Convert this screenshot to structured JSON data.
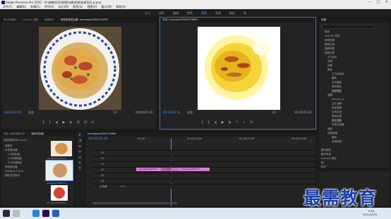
{
  "window": {
    "title": "Adobe Premiere Pro 2020 - D:\\做教程\\SO视频\\电影视频\\新建项目.prproj",
    "minimize": "—",
    "maximize": "□",
    "close": "✕"
  },
  "menu": [
    "文件(F)",
    "编辑(E)",
    "剪辑(C)",
    "序列(S)",
    "标记(M)",
    "图形(G)",
    "视图(V)",
    "窗口(W)",
    "帮助(H)"
  ],
  "workspaces": [
    "学习",
    "组件",
    "编辑",
    "颜色",
    "效果",
    "音频",
    "图形",
    "库"
  ],
  "active_workspace": "效果",
  "source_monitor": {
    "tabs": [
      "源:(无剪辑)",
      "Lumetri 范围",
      "效果控件",
      "音频剪辑混合器: mmexport1635174659"
    ],
    "timecode": "00;00;00;00",
    "fit": "适合",
    "ratio": "1/2",
    "end": "00;00;05;00"
  },
  "program_monitor": {
    "tabs": [
      "节目: mmexport1635174669"
    ],
    "timecode": "00;00;02;16",
    "fit": "适合",
    "ratio": "1/2",
    "end": "00;00;05;18"
  },
  "project": {
    "tabs": [
      "项目: 电影视频文件",
      "媒体浏览器",
      "库",
      "信息",
      "效果"
    ],
    "path": "电影视频文件.prproj",
    "items": [
      "mmexport163517...",
      "mmexport163517...",
      "mmexport163517..."
    ],
    "folder_items": [
      "收藏夹",
      "本地驱动器",
      "C:(系统/盘)",
      "D:(本地磁盘)",
      "E:(本地磁盘)",
      "网络驱动器",
      "Creative Cloud",
      "团队项目版本"
    ]
  },
  "timeline": {
    "tab": "mmexport1635174669",
    "timecode": "00;00;02;16",
    "ruler": [
      "00;00",
      "00;00;05;00",
      "00;00;10;00",
      "00;00;15;00"
    ],
    "video_tracks": [
      "V3",
      "V2",
      "V1"
    ],
    "audio_tracks": [
      "A1",
      "A2",
      "A3"
    ],
    "master": "主声道",
    "master_val": "0.0",
    "clip_a": "mmexport163517",
    "clip_b": "交叉溶解",
    "clip_c": "mmexport163517..."
  },
  "effects": {
    "title": "效果",
    "tree": [
      "预设",
      "Lumetri 预设",
      "音频效果",
      "音频过渡",
      "视频效果",
      "视频过渡",
      "3D 运动",
      "内滑",
      "划像",
      "擦除",
      "立方体旋转",
      "翻转",
      "交叉缩放",
      "带状擦除",
      "渐变擦除",
      "溶解",
      "MorphCut",
      "交叉溶解",
      "叠加溶解",
      "白场过渡",
      "黑场过渡",
      "胶片溶解",
      "非叠加溶解",
      "缩放",
      "页面剥落",
      "翻页",
      "页面剥落"
    ],
    "bottom": [
      "基本图形",
      "基本声音",
      "Lumetri 颜色",
      "库",
      "标记",
      "历史记录"
    ]
  },
  "taskbar": {
    "time": "9:48",
    "date": "2021/10/25"
  },
  "watermark": "最需教育",
  "colors": {
    "accent": "#4e95ff",
    "clip": "#d77ed0",
    "watermark": "#1c3fa8"
  }
}
